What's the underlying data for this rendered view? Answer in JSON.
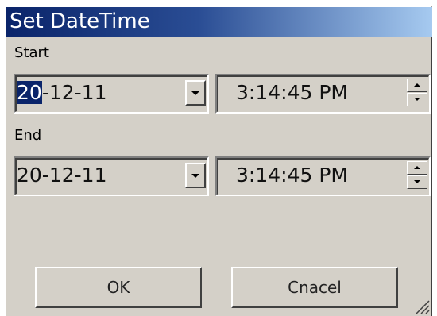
{
  "window": {
    "title": "Set DateTime"
  },
  "start": {
    "label": "Start",
    "date_selected": "20",
    "date_rest": "-12-11",
    "time": "3:14:45 PM"
  },
  "end": {
    "label": "End",
    "date": "20-12-11",
    "time": "3:14:45 PM"
  },
  "buttons": {
    "ok": "OK",
    "cancel": "Cnacel"
  },
  "colors": {
    "titlebar_start": "#0a246a",
    "titlebar_end": "#a6caf0",
    "face": "#d4d0c8",
    "selection": "#0a246a"
  },
  "icons": {
    "dropdown": "chevron-down-icon",
    "spin_up": "arrow-up-icon",
    "spin_down": "arrow-down-icon",
    "resize": "resize-grip-icon"
  }
}
